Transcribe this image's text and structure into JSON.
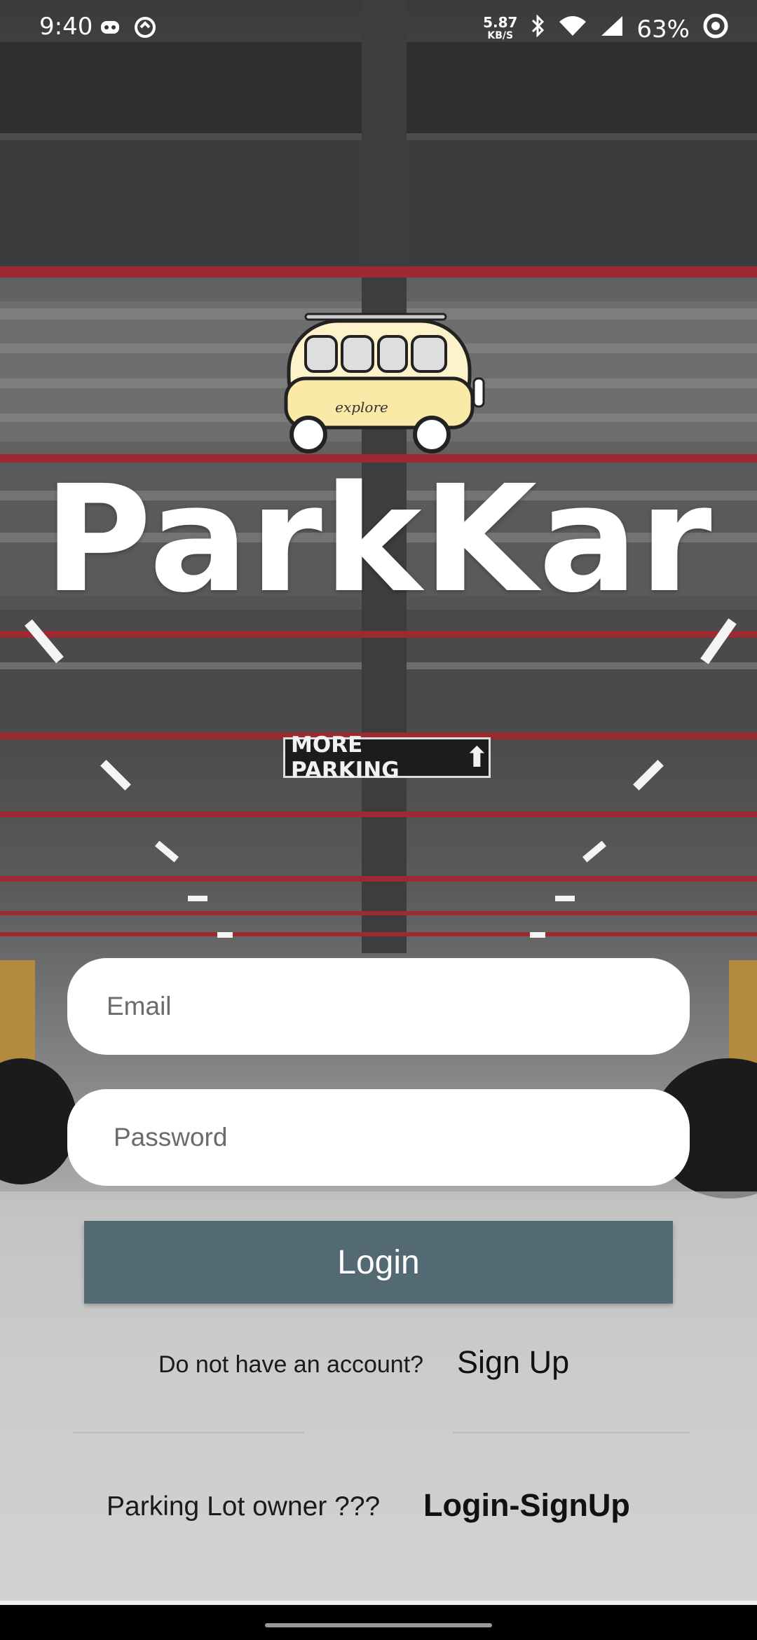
{
  "status_bar": {
    "time": "9:40",
    "network_speed_value": "5.87",
    "network_speed_unit": "KB/S",
    "battery": "63%",
    "icons": [
      "discord-icon",
      "sync-icon",
      "bluetooth-icon",
      "wifi-icon",
      "signal-icon",
      "battery-icon"
    ]
  },
  "app": {
    "brand": "ParkKar",
    "logo_text": "explore"
  },
  "background": {
    "sign_text": "MORE PARKING",
    "accent_red": "#9b2a33"
  },
  "form": {
    "email_placeholder": "Email",
    "password_placeholder": "Password",
    "login_label": "Login",
    "login_color": "#536a75"
  },
  "signup": {
    "question": "Do not have an account?",
    "link_label": "Sign Up"
  },
  "owner": {
    "question": "Parking Lot owner ???",
    "link_label": "Login-SignUp"
  }
}
